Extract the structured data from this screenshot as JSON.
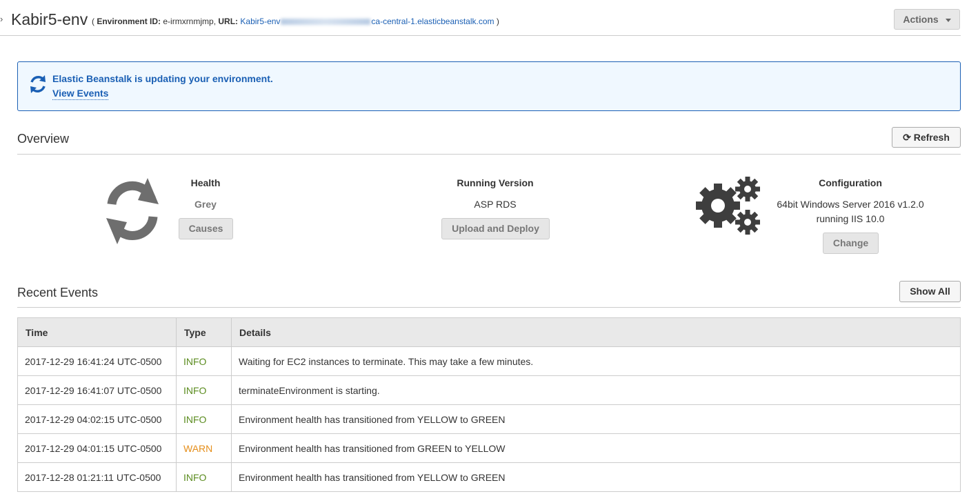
{
  "header": {
    "chevron": "›",
    "env_name": "Kabir5-env",
    "meta_open": "( ",
    "env_id_label": "Environment ID:",
    "env_id": "e-irmxrnmjmp,",
    "url_label": "URL:",
    "url_prefix": "Kabir5-env",
    "url_suffix": "ca-central-1.elasticbeanstalk.com",
    "meta_close": " )",
    "actions_label": "Actions"
  },
  "alert": {
    "message": "Elastic Beanstalk is updating your environment.",
    "link": "View Events",
    "color": "#1a5fb4"
  },
  "overview": {
    "title": "Overview",
    "refresh_label": "Refresh",
    "health": {
      "title": "Health",
      "value": "Grey",
      "button": "Causes"
    },
    "running_version": {
      "title": "Running Version",
      "value": "ASP RDS",
      "button": "Upload and Deploy"
    },
    "configuration": {
      "title": "Configuration",
      "value_line1": "64bit Windows Server 2016 v1.2.0",
      "value_line2": "running IIS 10.0",
      "button": "Change"
    }
  },
  "recent_events": {
    "title": "Recent Events",
    "show_all_label": "Show All",
    "columns": [
      "Time",
      "Type",
      "Details"
    ],
    "rows": [
      {
        "time": "2017-12-29 16:41:24 UTC-0500",
        "type": "INFO",
        "details": "Waiting for EC2 instances to terminate. This may take a few minutes."
      },
      {
        "time": "2017-12-29 16:41:07 UTC-0500",
        "type": "INFO",
        "details": "terminateEnvironment is starting."
      },
      {
        "time": "2017-12-29 04:02:15 UTC-0500",
        "type": "INFO",
        "details": "Environment health has transitioned from YELLOW to GREEN"
      },
      {
        "time": "2017-12-29 04:01:15 UTC-0500",
        "type": "WARN",
        "details": "Environment health has transitioned from GREEN to YELLOW"
      },
      {
        "time": "2017-12-28 01:21:11 UTC-0500",
        "type": "INFO",
        "details": "Environment health has transitioned from YELLOW to GREEN"
      }
    ]
  },
  "colors": {
    "info": "#5b8c1f",
    "warn": "#e58e1a",
    "link": "#1a5fb4"
  }
}
